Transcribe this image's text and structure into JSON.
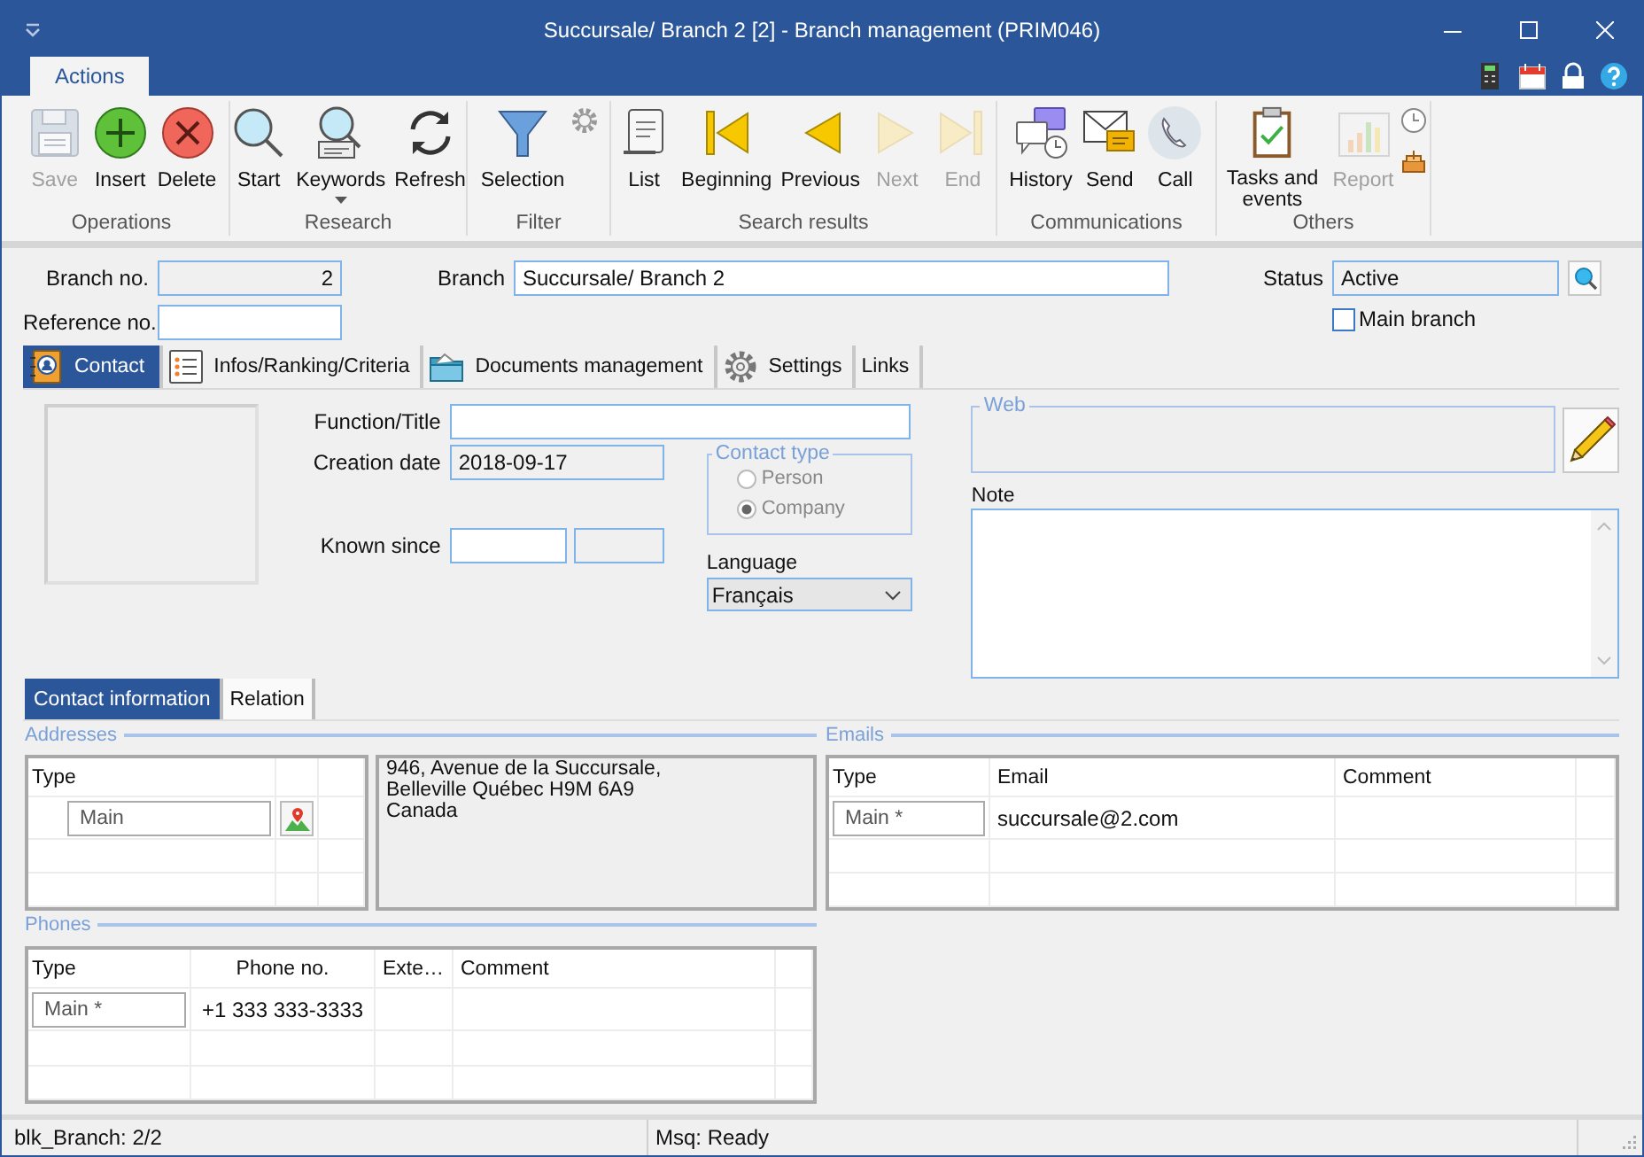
{
  "window": {
    "title": "Succursale/ Branch 2 [2] - Branch management (PRIM046)"
  },
  "ribbon": {
    "tabs": [
      {
        "label": "Actions",
        "selected": true
      }
    ],
    "groups": [
      {
        "label": "Operations",
        "buttons": [
          {
            "label": "Save",
            "disabled": true
          },
          {
            "label": "Insert",
            "disabled": false
          },
          {
            "label": "Delete",
            "disabled": false
          }
        ]
      },
      {
        "label": "Research",
        "buttons": [
          {
            "label": "Start",
            "disabled": false
          },
          {
            "label": "Keywords",
            "disabled": false,
            "dropdown": true
          },
          {
            "label": "Refresh",
            "disabled": false
          }
        ]
      },
      {
        "label": "Filter",
        "buttons": [
          {
            "label": "Selection",
            "disabled": false
          }
        ]
      },
      {
        "label": "Search results",
        "buttons": [
          {
            "label": "List",
            "disabled": false
          },
          {
            "label": "Beginning",
            "disabled": false
          },
          {
            "label": "Previous",
            "disabled": false
          },
          {
            "label": "Next",
            "disabled": true
          },
          {
            "label": "End",
            "disabled": true
          }
        ]
      },
      {
        "label": "Communications",
        "buttons": [
          {
            "label": "History",
            "disabled": false
          },
          {
            "label": "Send",
            "disabled": false
          },
          {
            "label": "Call",
            "disabled": false
          }
        ]
      },
      {
        "label": "Others",
        "buttons": [
          {
            "label": "Tasks and events",
            "disabled": false
          },
          {
            "label": "Report",
            "disabled": true
          }
        ]
      }
    ]
  },
  "header": {
    "branch_no": {
      "label": "Branch no.",
      "value": "2"
    },
    "branch": {
      "label": "Branch",
      "value": "Succursale/ Branch 2"
    },
    "status": {
      "label": "Status",
      "value": "Active"
    },
    "reference_no": {
      "label": "Reference no."
    },
    "main_branch": {
      "label": "Main branch",
      "checked": false
    }
  },
  "tabs": [
    {
      "label": "Contact",
      "selected": true
    },
    {
      "label": "Infos/Ranking/Criteria",
      "selected": false
    },
    {
      "label": "Documents management",
      "selected": false
    },
    {
      "label": "Settings",
      "selected": false
    },
    {
      "label": "Links",
      "selected": false
    }
  ],
  "contact": {
    "function_title": {
      "label": "Function/Title"
    },
    "creation_date": {
      "label": "Creation date",
      "value": "2018-09-17"
    },
    "known_since": {
      "label": "Known since"
    },
    "contact_type": {
      "label": "Contact type",
      "disabled": true,
      "options": [
        {
          "label": "Person",
          "selected": false
        },
        {
          "label": "Company",
          "selected": true
        }
      ]
    },
    "language": {
      "label": "Language",
      "value": "Français"
    },
    "web": {
      "label": "Web"
    },
    "note": {
      "label": "Note"
    }
  },
  "contact_tabs": [
    {
      "label": "Contact information",
      "selected": true
    },
    {
      "label": "Relation",
      "selected": false
    }
  ],
  "addresses": {
    "label": "Addresses",
    "column": "Type",
    "type": "Main",
    "address": "946, Avenue de la Succursale,\nBelleville Québec H9M 6A9\nCanada"
  },
  "emails": {
    "label": "Emails",
    "columns": [
      "Type",
      "Email",
      "Comment"
    ],
    "rows": [
      {
        "type": "Main *",
        "email": "succursale@2.com"
      }
    ]
  },
  "phones": {
    "label": "Phones",
    "columns": [
      "Type",
      "Phone no.",
      "Exte…",
      "Comment"
    ],
    "rows": [
      {
        "type": "Main *",
        "phone_no": "+1 333 333-3333"
      }
    ]
  },
  "status_bar": [
    "blk_Branch: 2/2",
    "Msq: Ready"
  ]
}
